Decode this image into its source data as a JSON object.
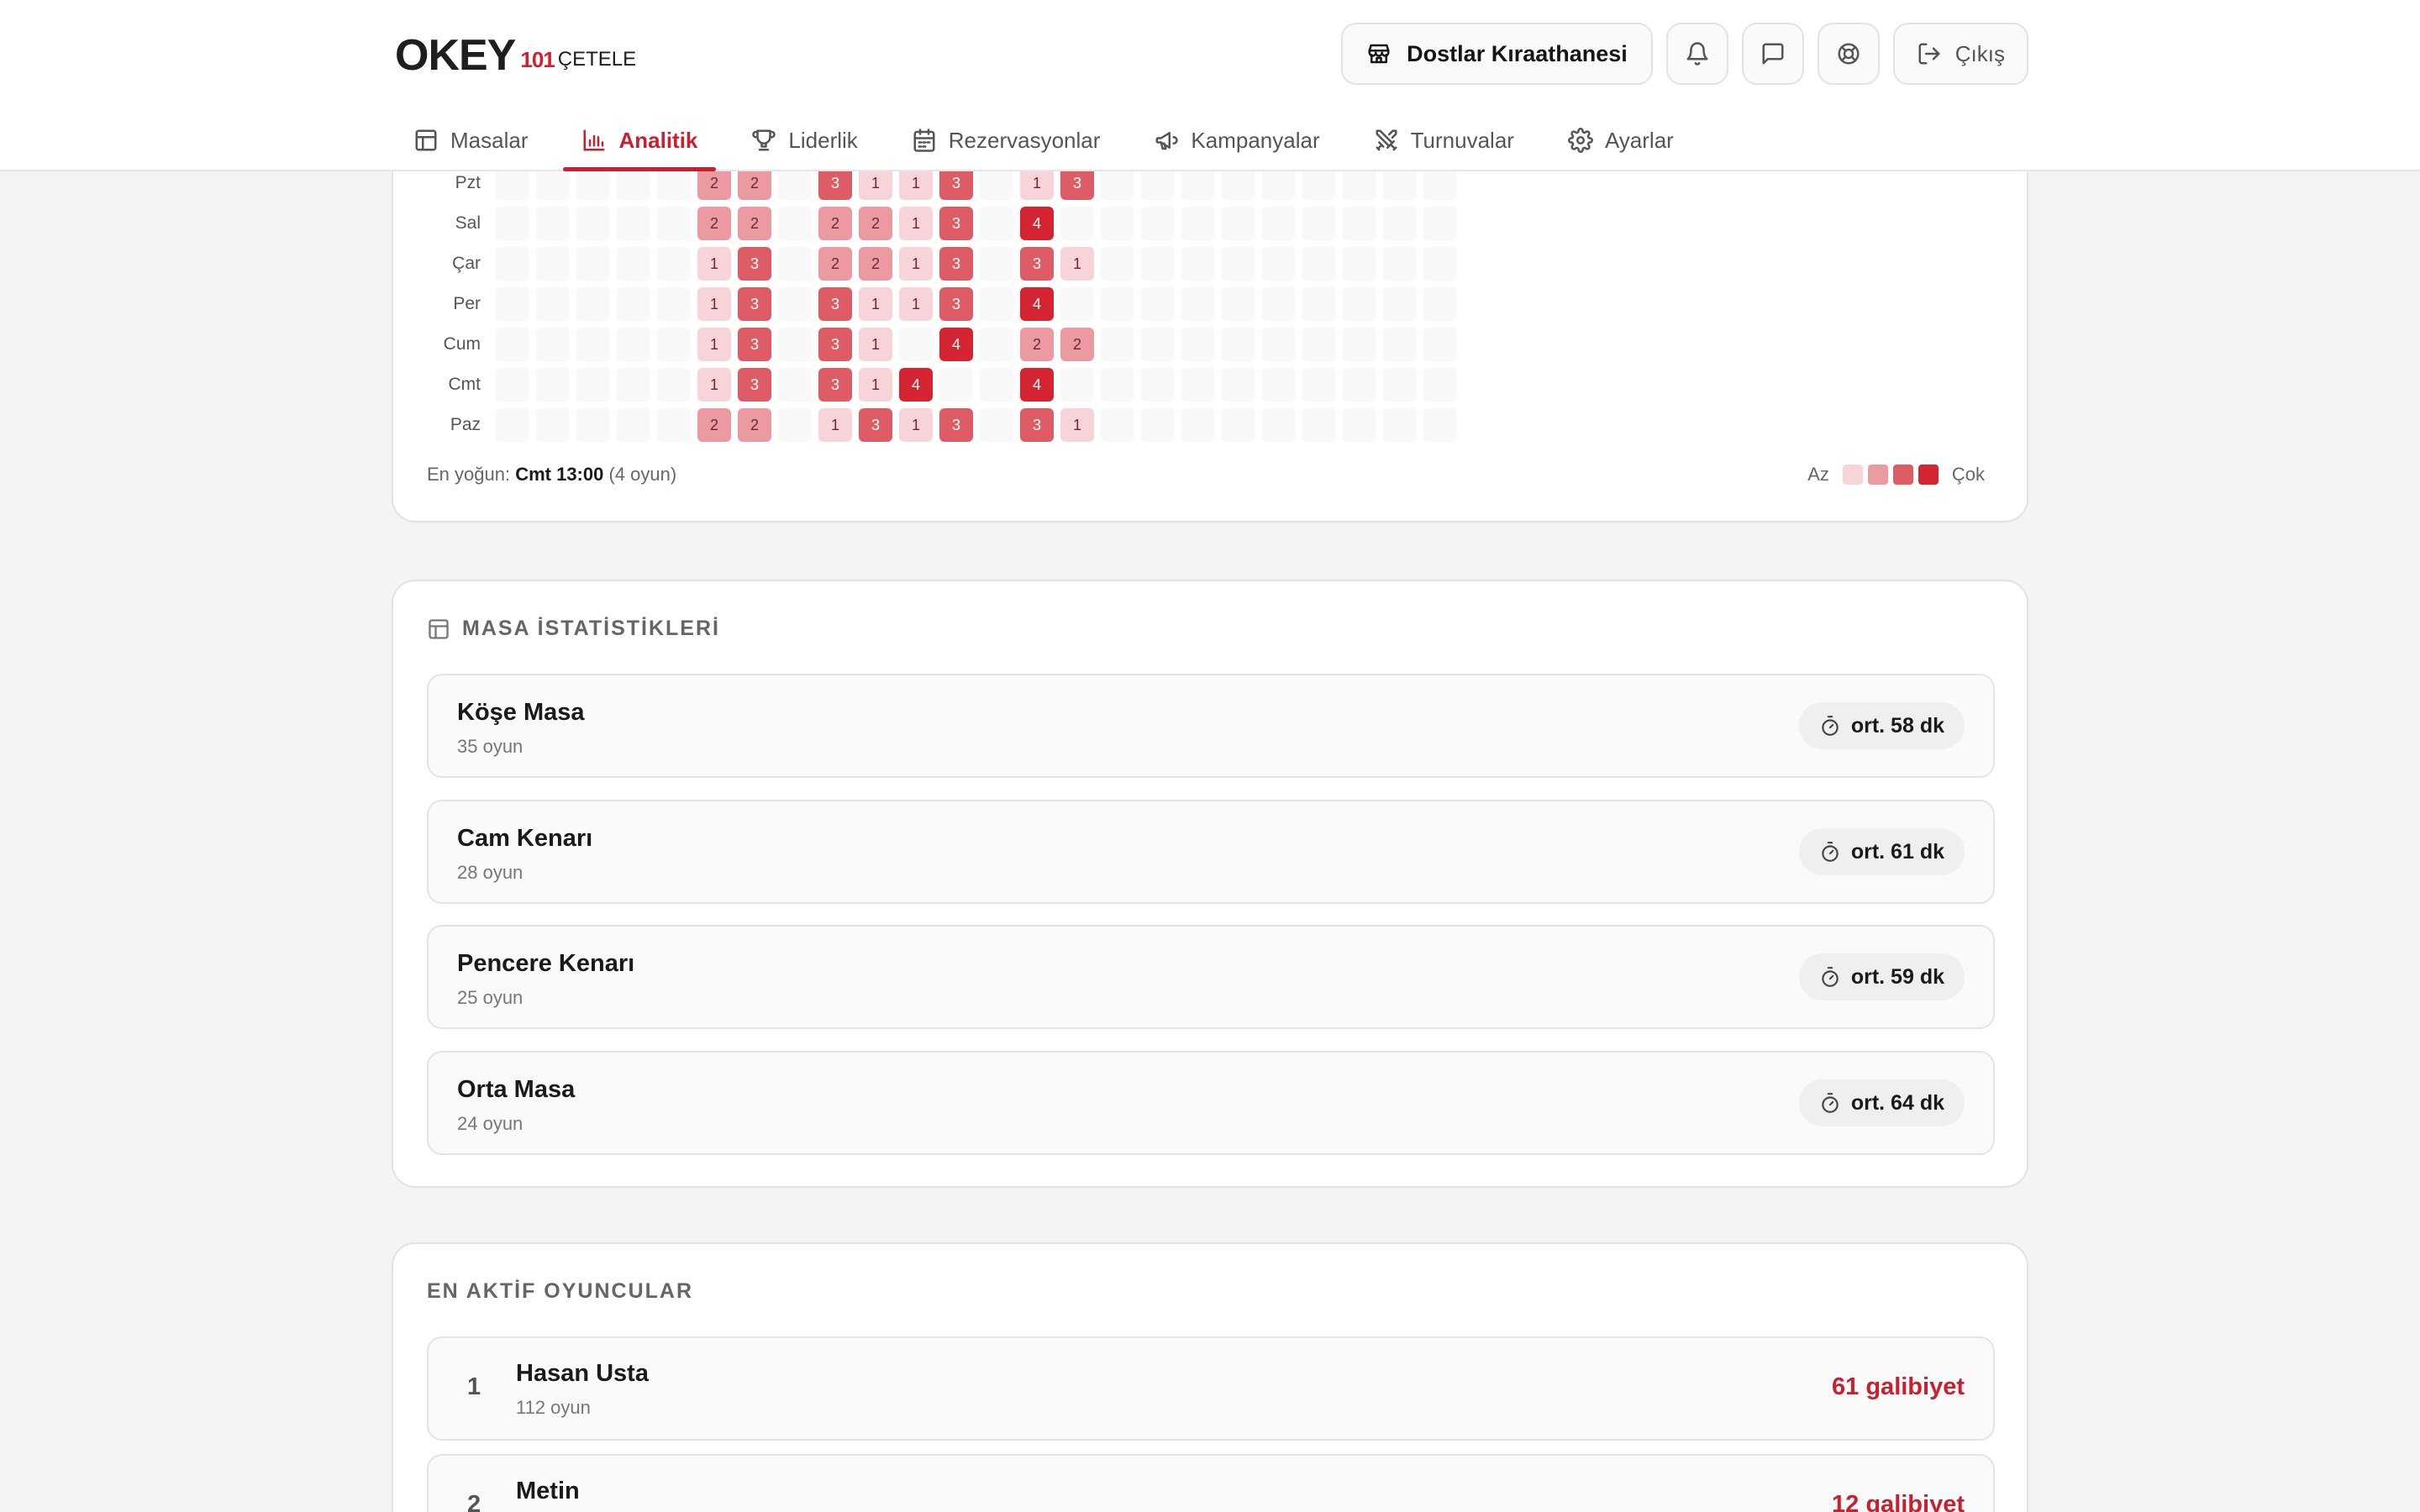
{
  "brand": {
    "logo_main": "OKEY",
    "logo_num": "101",
    "logo_sub": "ÇETELE"
  },
  "header": {
    "venue_name": "Dostlar Kıraathanesi",
    "exit_label": "Çıkış"
  },
  "nav": [
    {
      "label": "Masalar",
      "icon": "table-icon"
    },
    {
      "label": "Analitik",
      "icon": "chart-icon",
      "active": true
    },
    {
      "label": "Liderlik",
      "icon": "trophy-icon"
    },
    {
      "label": "Rezervasyonlar",
      "icon": "calendar-icon"
    },
    {
      "label": "Kampanyalar",
      "icon": "megaphone-icon"
    },
    {
      "label": "Turnuvalar",
      "icon": "swords-icon"
    },
    {
      "label": "Ayarlar",
      "icon": "gear-icon"
    }
  ],
  "heatmap": {
    "days": [
      "Pzt",
      "Sal",
      "Çar",
      "Per",
      "Cum",
      "Cmt",
      "Paz"
    ],
    "columns": 24,
    "values": [
      [
        0,
        0,
        0,
        0,
        0,
        2,
        2,
        0,
        3,
        1,
        1,
        3,
        0,
        1,
        3,
        0,
        0,
        0,
        0,
        0,
        0,
        0,
        0,
        0
      ],
      [
        0,
        0,
        0,
        0,
        0,
        2,
        2,
        0,
        2,
        2,
        1,
        3,
        0,
        4,
        0,
        0,
        0,
        0,
        0,
        0,
        0,
        0,
        0,
        0
      ],
      [
        0,
        0,
        0,
        0,
        0,
        1,
        3,
        0,
        2,
        2,
        1,
        3,
        0,
        3,
        1,
        0,
        0,
        0,
        0,
        0,
        0,
        0,
        0,
        0
      ],
      [
        0,
        0,
        0,
        0,
        0,
        1,
        3,
        0,
        3,
        1,
        1,
        3,
        0,
        4,
        0,
        0,
        0,
        0,
        0,
        0,
        0,
        0,
        0,
        0
      ],
      [
        0,
        0,
        0,
        0,
        0,
        1,
        3,
        0,
        3,
        1,
        0,
        4,
        0,
        2,
        2,
        0,
        0,
        0,
        0,
        0,
        0,
        0,
        0,
        0
      ],
      [
        0,
        0,
        0,
        0,
        0,
        1,
        3,
        0,
        3,
        1,
        4,
        0,
        0,
        4,
        0,
        0,
        0,
        0,
        0,
        0,
        0,
        0,
        0,
        0
      ],
      [
        0,
        0,
        0,
        0,
        0,
        2,
        2,
        0,
        1,
        3,
        1,
        3,
        0,
        3,
        1,
        0,
        0,
        0,
        0,
        0,
        0,
        0,
        0,
        0
      ]
    ],
    "peak_prefix": "En yoğun:",
    "peak_value": "Cmt 13:00",
    "peak_suffix": "(4 oyun)",
    "legend_low": "Az",
    "legend_high": "Çok",
    "colors": [
      "#f8f8f8",
      "#f6d4d7",
      "#ec9aa1",
      "#de5c66",
      "#d42331"
    ]
  },
  "tables_section": {
    "title": "MASA İSTATİSTİKLERİ",
    "rows": [
      {
        "name": "Köşe Masa",
        "games": "35 oyun",
        "avg": "ort. 58 dk"
      },
      {
        "name": "Cam Kenarı",
        "games": "28 oyun",
        "avg": "ort. 61 dk"
      },
      {
        "name": "Pencere Kenarı",
        "games": "25 oyun",
        "avg": "ort. 59 dk"
      },
      {
        "name": "Orta Masa",
        "games": "24 oyun",
        "avg": "ort. 64 dk"
      }
    ]
  },
  "players_section": {
    "title": "EN AKTİF OYUNCULAR",
    "rows": [
      {
        "rank": "1",
        "name": "Hasan Usta",
        "games": "112 oyun",
        "wins": "61 galibiyet"
      },
      {
        "rank": "2",
        "name": "Metin",
        "games": "",
        "wins": "12 galibiyet"
      }
    ]
  }
}
